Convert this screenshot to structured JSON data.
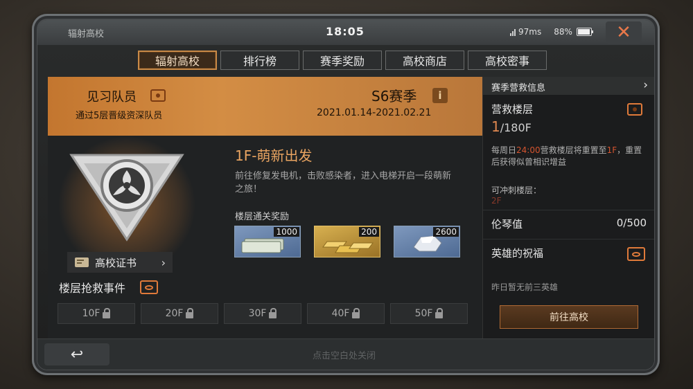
{
  "app": {
    "title": "辐射高校"
  },
  "statusbar": {
    "time": "18:05",
    "ping": "97ms",
    "battery": "88%",
    "battery_level": 88
  },
  "tabs": [
    {
      "label": "辐射高校",
      "active": true
    },
    {
      "label": "排行榜",
      "active": false
    },
    {
      "label": "赛季奖励",
      "active": false
    },
    {
      "label": "高校商店",
      "active": false
    },
    {
      "label": "高校密事",
      "active": false
    }
  ],
  "rank": {
    "title": "见习队员",
    "subtitle": "通过5层晋级资深队员"
  },
  "season": {
    "name": "S6赛季",
    "dates": "2021.01.14-2021.02.21",
    "info_icon": "i"
  },
  "certificate": {
    "label": "高校证书"
  },
  "floor": {
    "title": "1F-萌新出发",
    "description": "前往修复发电机，击败感染者，进入电梯开启一段萌新之旅！",
    "reward_label": "楼层通关奖励",
    "rewards": [
      {
        "icon": "cash-stack-icon",
        "qty": "1000"
      },
      {
        "icon": "gold-bars-icon",
        "qty": "200"
      },
      {
        "icon": "silver-ore-icon",
        "qty": "2600"
      }
    ]
  },
  "rescue_events": {
    "title": "楼层抢救事件",
    "floors": [
      "10F",
      "20F",
      "30F",
      "40F",
      "50F"
    ]
  },
  "side": {
    "header": "赛季营救信息",
    "rescue_floor_label": "营救楼层",
    "current_floor": "1",
    "max_floor": "/180F",
    "reset_note_prefix": "每周日",
    "reset_time": "24:00",
    "reset_note_mid": "营救楼层将重置至",
    "reset_floor": "1F",
    "reset_note_suffix": "，重置后获得似曾相识增益",
    "sprint_label": "可冲刺楼层：",
    "sprint_value": "2F",
    "piano_label": "伦琴值",
    "piano_value": "0/500",
    "blessing_label": "英雄的祝福",
    "no_hero": "昨日暂无前三英雄",
    "go_button": "前往高校"
  },
  "bottom": {
    "hint": "点击空白处关闭"
  },
  "colors": {
    "accent": "#d38d44",
    "highlight": "#d4542f",
    "tab_active_border": "#c98a47"
  }
}
